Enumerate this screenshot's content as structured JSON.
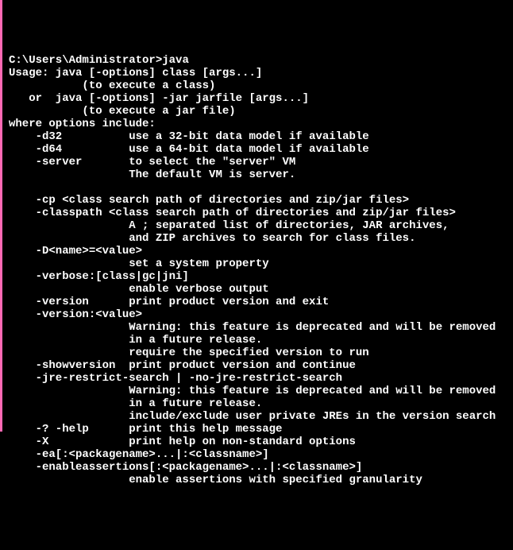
{
  "terminal": {
    "prompt": "C:\\Users\\Administrator>",
    "command": "java",
    "lines": [
      "Usage: java [-options] class [args...]",
      "           (to execute a class)",
      "   or  java [-options] -jar jarfile [args...]",
      "           (to execute a jar file)",
      "where options include:",
      "    -d32          use a 32-bit data model if available",
      "    -d64          use a 64-bit data model if available",
      "    -server       to select the \"server\" VM",
      "                  The default VM is server.",
      "",
      "    -cp <class search path of directories and zip/jar files>",
      "    -classpath <class search path of directories and zip/jar files>",
      "                  A ; separated list of directories, JAR archives,",
      "                  and ZIP archives to search for class files.",
      "    -D<name>=<value>",
      "                  set a system property",
      "    -verbose:[class|gc|jni]",
      "                  enable verbose output",
      "    -version      print product version and exit",
      "    -version:<value>",
      "                  Warning: this feature is deprecated and will be removed",
      "                  in a future release.",
      "                  require the specified version to run",
      "    -showversion  print product version and continue",
      "    -jre-restrict-search | -no-jre-restrict-search",
      "                  Warning: this feature is deprecated and will be removed",
      "                  in a future release.",
      "                  include/exclude user private JREs in the version search",
      "    -? -help      print this help message",
      "    -X            print help on non-standard options",
      "    -ea[:<packagename>...|:<classname>]",
      "    -enableassertions[:<packagename>...|:<classname>]",
      "                  enable assertions with specified granularity"
    ]
  }
}
